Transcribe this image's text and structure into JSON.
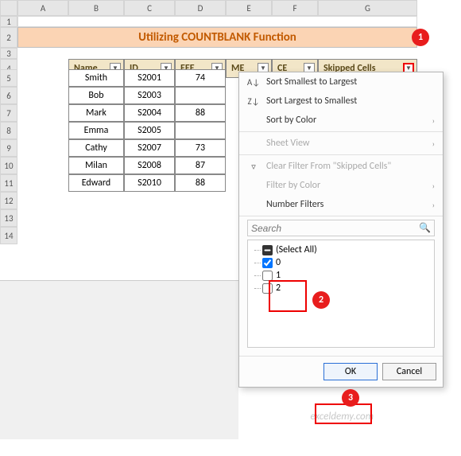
{
  "columns": [
    "A",
    "B",
    "C",
    "D",
    "E",
    "F",
    "G"
  ],
  "rows": [
    "1",
    "2",
    "3",
    "4",
    "5",
    "6",
    "7",
    "8",
    "9",
    "10",
    "11",
    "12",
    "13",
    "14"
  ],
  "title": "Utilizing COUNTBLANK Function",
  "headers": {
    "name": "Name",
    "id": "ID",
    "eee": "EEE",
    "me": "ME",
    "ce": "CE",
    "skipped": "Skipped Cells"
  },
  "data": [
    {
      "name": "Smith",
      "id": "S2001",
      "eee": "74"
    },
    {
      "name": "Bob",
      "id": "S2003",
      "eee": ""
    },
    {
      "name": "Mark",
      "id": "S2004",
      "eee": "88"
    },
    {
      "name": "Emma",
      "id": "S2005",
      "eee": ""
    },
    {
      "name": "Cathy",
      "id": "S2007",
      "eee": "73"
    },
    {
      "name": "Milan",
      "id": "S2008",
      "eee": "87"
    },
    {
      "name": "Edward",
      "id": "S2010",
      "eee": "88"
    }
  ],
  "menu": {
    "sort_asc": "Sort Smallest to Largest",
    "sort_desc": "Sort Largest to Smallest",
    "sort_color": "Sort by Color",
    "sheet_view": "Sheet View",
    "clear": "Clear Filter From \"Skipped Cells\"",
    "filter_color": "Filter by Color",
    "num_filters": "Number Filters",
    "search_ph": "Search",
    "select_all": "(Select All)",
    "opt0": "0",
    "opt1": "1",
    "opt2": "2",
    "ok": "OK",
    "cancel": "Cancel"
  },
  "badges": {
    "b1": "1",
    "b2": "2",
    "b3": "3"
  },
  "watermark": "exceldemy.com"
}
